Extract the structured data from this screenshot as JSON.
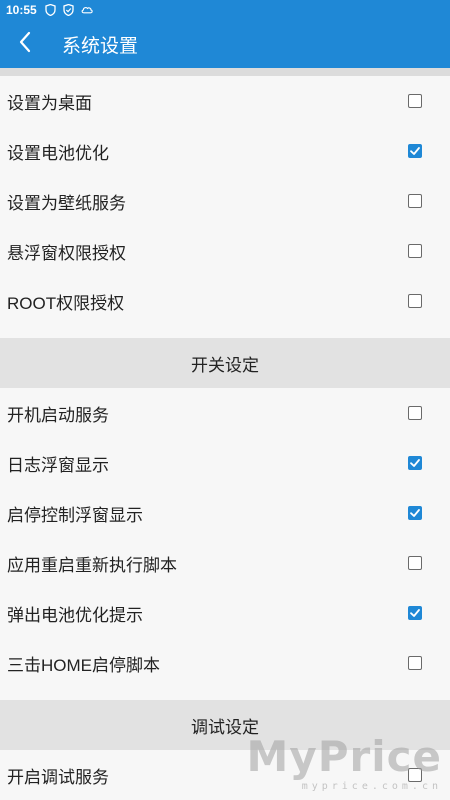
{
  "status_bar": {
    "time": "10:55",
    "icons": [
      "shield-icon",
      "shield-check-icon",
      "cloud-icon"
    ]
  },
  "app_bar": {
    "title": "系统设置",
    "back_icon": "chevron-left-icon"
  },
  "colors": {
    "primary": "#1f88d6",
    "section_bg": "#e2e2e2",
    "list_bg": "#f7f7f7"
  },
  "group1": [
    {
      "label": "设置为桌面",
      "checked": false
    },
    {
      "label": "设置电池优化",
      "checked": true
    },
    {
      "label": "设置为壁纸服务",
      "checked": false
    },
    {
      "label": "悬浮窗权限授权",
      "checked": false
    },
    {
      "label": "ROOT权限授权",
      "checked": false
    }
  ],
  "section_switch": "开关设定",
  "group2": [
    {
      "label": "开机启动服务",
      "checked": false
    },
    {
      "label": "日志浮窗显示",
      "checked": true
    },
    {
      "label": "启停控制浮窗显示",
      "checked": true
    },
    {
      "label": "应用重启重新执行脚本",
      "checked": false
    },
    {
      "label": "弹出电池优化提示",
      "checked": true
    },
    {
      "label": "三击HOME启停脚本",
      "checked": false
    }
  ],
  "section_debug": "调试设定",
  "group3": [
    {
      "label": "开启调试服务",
      "checked": false
    }
  ],
  "watermark": {
    "main": "MyPrice",
    "sub": "myprice.com.cn"
  }
}
